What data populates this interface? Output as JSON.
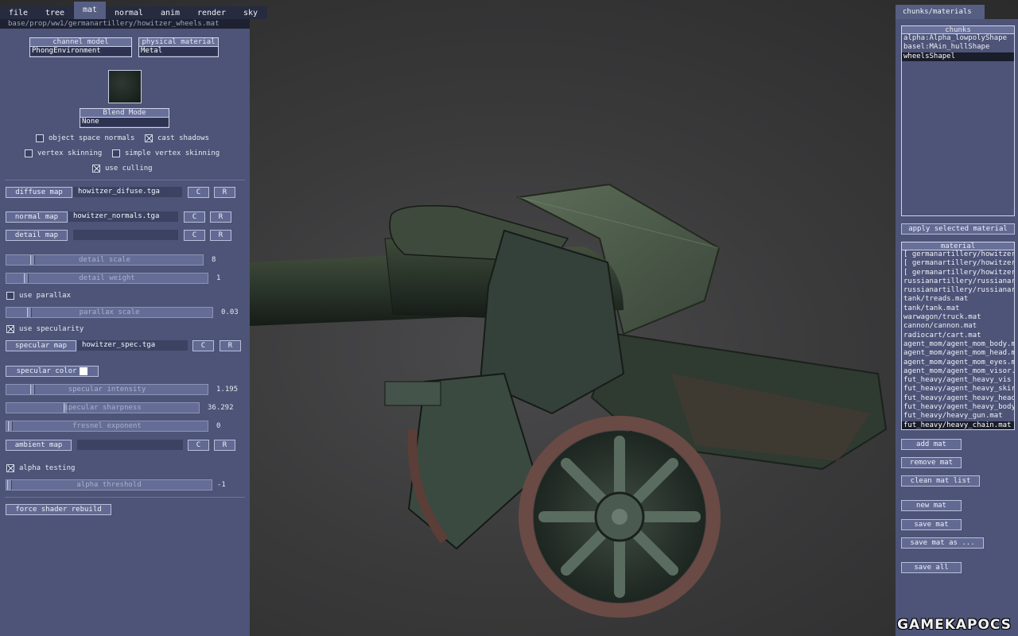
{
  "menu": [
    "file",
    "tree",
    "mat",
    "normal",
    "anim",
    "render",
    "sky"
  ],
  "path": "base/prop/ww1/germanartillery/howitzer_wheels.mat",
  "channel_model": {
    "label": "channel model",
    "value": "PhongEnvironment"
  },
  "physical_material": {
    "label": "physical material",
    "value": "Metal"
  },
  "blend_mode": {
    "label": "Blend Mode",
    "value": "None"
  },
  "checks": {
    "object_space_normals": "object space normals",
    "cast_shadows": "cast shadows",
    "vertex_skinning": "vertex skinning",
    "simple_vertex_skinning": "simple vertex skinning",
    "use_culling": "use culling",
    "use_parallax": "use parallax",
    "use_specularity": "use specularity",
    "alpha_testing": "alpha testing"
  },
  "maps": {
    "diffuse": {
      "label": "diffuse map",
      "file": "howitzer_difuse.tga"
    },
    "normal": {
      "label": "normal map",
      "file": "howitzer_normals.tga"
    },
    "detail": {
      "label": "detail map",
      "file": ""
    },
    "specular": {
      "label": "specular map",
      "file": "howitzer_spec.tga"
    },
    "ambient": {
      "label": "ambient map",
      "file": ""
    },
    "c": "C",
    "r": "R"
  },
  "sliders": {
    "detail_scale": {
      "label": "detail scale",
      "value": "8"
    },
    "detail_weight": {
      "label": "detail weight",
      "value": "1"
    },
    "parallax_scale": {
      "label": "parallax scale",
      "value": "0.03"
    },
    "specular_intensity": {
      "label": "specular intensity",
      "value": "1.195"
    },
    "specular_sharpness": {
      "label": "specular sharpness",
      "value": "36.292"
    },
    "fresnel_exponent": {
      "label": "fresnel exponent",
      "value": "0"
    },
    "alpha_threshold": {
      "label": "alpha threshold",
      "value": "-1"
    }
  },
  "specular_color_label": "specular color",
  "force_rebuild": "force shader rebuild",
  "right_tab": "chunks/materials",
  "chunks": {
    "label": "chunks",
    "items": [
      "alpha:Alpha_lowpolyShape",
      "basel:MAin_hullShape",
      "wheelsShapel"
    ]
  },
  "apply_selected": "apply selected material",
  "materials": {
    "label": "material",
    "items": [
      "[ germanartillery/howitzer",
      "[ germanartillery/howitzer",
      "[ germanartillery/howitzer",
      "russianartillery/russianar",
      "russianartillery/russianar",
      "tank/treads.mat",
      "tank/tank.mat",
      "warwagon/truck.mat",
      "cannon/cannon.mat",
      "radiocart/cart.mat",
      "agent_mom/agent_mom_body.m",
      "agent_mom/agent_mom_head.m",
      "agent_mom/agent_mom_eyes.m",
      "agent_mom/agent_mom_visor.",
      "fut_heavy/agent_heavy_vis",
      "fut_heavy/agent_heavy_skir",
      "fut_heavy/agent_heavy_head",
      "fut_heavy/agent_heavy_body",
      "fut_heavy/heavy_gun.mat",
      "fut_heavy/heavy_chain.mat"
    ]
  },
  "buttons": {
    "add_mat": "add mat",
    "remove_mat": "remove mat",
    "clean_mat_list": "clean mat list",
    "new_mat": "new mat",
    "save_mat": "save mat",
    "save_mat_as": "save mat as ...",
    "save_all": "save all"
  },
  "watermark": "GAMEKAPOCS"
}
